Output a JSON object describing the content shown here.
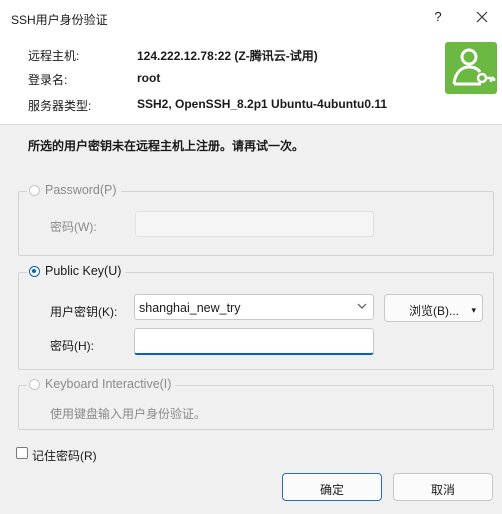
{
  "window": {
    "title": "SSH用户身份验证",
    "help": "?"
  },
  "header": {
    "rows": [
      {
        "label": "远程主机:",
        "value": "124.222.12.78:22 (Z-腾讯云-试用)"
      },
      {
        "label": "登录名:",
        "value": "root"
      },
      {
        "label": "服务器类型:",
        "value": "SSH2, OpenSSH_8.2p1 Ubuntu-4ubuntu0.11"
      }
    ],
    "logo_icon": "user-key-icon",
    "logo_color": "#6bb843"
  },
  "message": "所选的用户密钥未在远程主机上注册。请再试一次。",
  "password_group": {
    "label": "Password(P)",
    "selected": false,
    "password_label": "密码(W):",
    "password_value": ""
  },
  "publickey_group": {
    "label": "Public Key(U)",
    "selected": true,
    "key_label": "用户密钥(K):",
    "key_value": "shanghai_new_try",
    "browse_label": "浏览(B)...",
    "password_label": "密码(H):",
    "password_value": ""
  },
  "keyboard_group": {
    "label": "Keyboard Interactive(I)",
    "selected": false,
    "description": "使用键盘输入用户身份验证。"
  },
  "remember_password": {
    "label": "记住密码(R)",
    "checked": false
  },
  "buttons": {
    "ok": "确定",
    "cancel": "取消"
  },
  "colors": {
    "accent": "#0b5cc4",
    "logo": "#6bb843"
  }
}
